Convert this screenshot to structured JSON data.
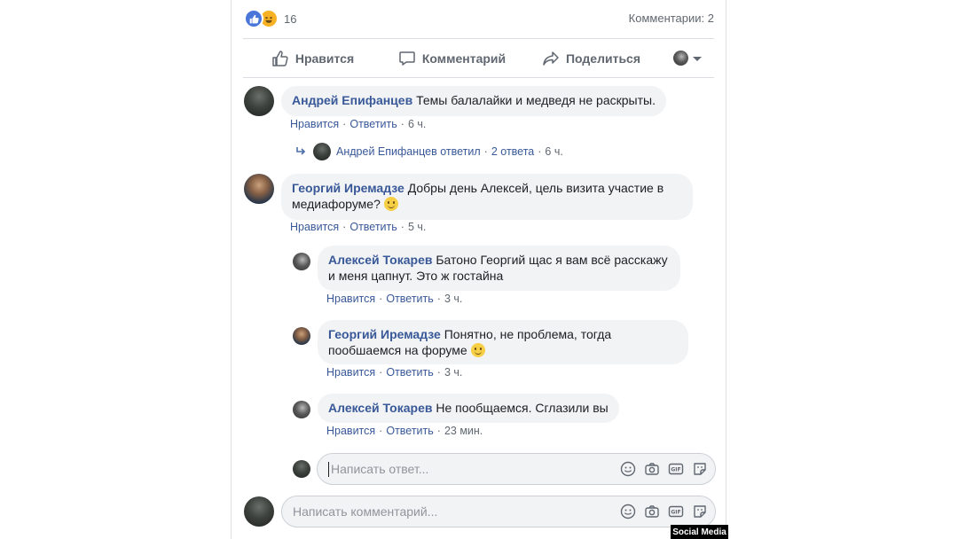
{
  "reactions": {
    "count": "16",
    "types": [
      "like-icon",
      "haha-icon"
    ],
    "colors": {
      "like": "#4a76d9",
      "haha": "#f7b125"
    }
  },
  "comments_count": "Комментарии: 2",
  "actions": {
    "like": "Нравится",
    "comment": "Комментарий",
    "share": "Поделиться"
  },
  "comment_actions": {
    "like": "Нравится",
    "reply": "Ответить"
  },
  "comments": [
    {
      "author": "Андрей Епифанцев",
      "text": "Темы балалайки и медведя не раскрыты.",
      "time": "6 ч.",
      "reply_summary": {
        "author": "Андрей Епифанцев",
        "action": "ответил",
        "count": "2 ответа",
        "time": "6 ч."
      }
    },
    {
      "author": "Георгий Иремадзе",
      "text_line1": "Добры день Алексей, цель визита участие в",
      "text_line2": "медиафоруме?",
      "time": "5 ч.",
      "replies": [
        {
          "author": "Алексей Токарев",
          "text_line1": "Батоно Георгий щас я вам всё расскажу",
          "text_line2": "и меня цапнут. Это ж гостайна",
          "time": "3 ч."
        },
        {
          "author": "Георгий Иремадзе",
          "text_line1": "Понятно, не проблема, тогда",
          "text_line2": "пообшаемся на форуме",
          "time": "3 ч."
        },
        {
          "author": "Алексей Токарев",
          "text": "Не пообщаемся. Сглазили вы",
          "time": "23 мин."
        }
      ]
    }
  ],
  "reply_input": {
    "placeholder": "Написать ответ..."
  },
  "comment_input": {
    "placeholder": "Написать комментарий..."
  },
  "input_tools": [
    "emoji-icon",
    "camera-icon",
    "gif-icon",
    "sticker-icon"
  ],
  "watermark": "Social Media",
  "accent_color": "#385898"
}
